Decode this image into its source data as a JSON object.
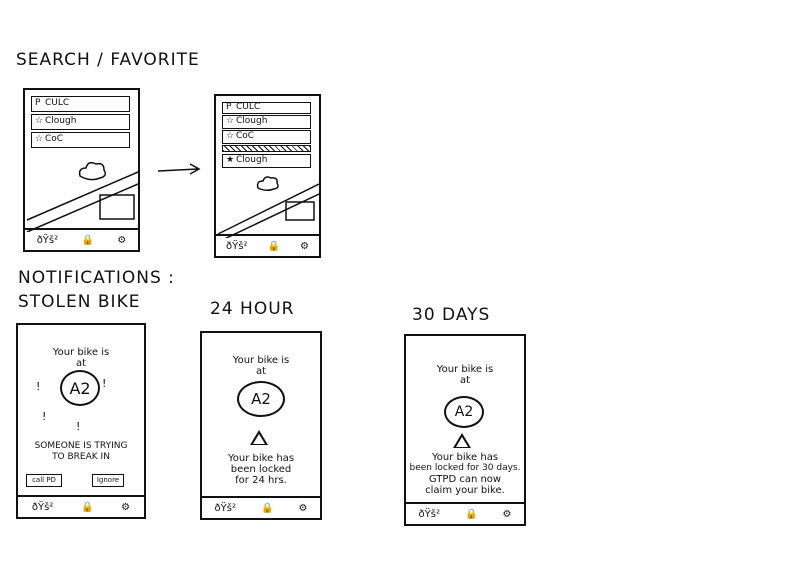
{
  "headings": {
    "search": "SEARCH / FAVORITE",
    "notifications": "NOTIFICATIONS :",
    "stolen": "STOLEN BIKE",
    "h24": "24 HOUR",
    "d30": "30 DAYS"
  },
  "search_before": {
    "rows": [
      {
        "icon": "P",
        "label": "CULC"
      },
      {
        "icon": "☆",
        "label": "Clough"
      },
      {
        "icon": "☆",
        "label": "CoC"
      }
    ]
  },
  "search_after": {
    "rows": [
      {
        "icon": "P",
        "label": "CULC"
      },
      {
        "icon": "☆",
        "label": "Clough"
      },
      {
        "icon": "☆",
        "label": "CoC"
      },
      {
        "icon": "★",
        "label": "Clough"
      }
    ]
  },
  "nav": {
    "bike": "ðŸš²",
    "lock": "🔒",
    "settings": "⚙"
  },
  "stolen": {
    "line1": "Your bike is",
    "line2": "at",
    "rack": "A2",
    "marks": "!",
    "alert1": "SOMEONE IS TRYING",
    "alert2": "TO BREAK IN",
    "call_btn": "call PD",
    "ignore_btn": "Ignore"
  },
  "h24": {
    "line1": "Your bike is",
    "line2": "at",
    "rack": "A2",
    "warn": "!",
    "msg1": "Your bike has",
    "msg2": "been locked",
    "msg3": "for 24 hrs."
  },
  "d30": {
    "line1": "Your bike is",
    "line2": "at",
    "rack": "A2",
    "warn": "!",
    "msg1": "Your bike has",
    "msg2": "been locked for 30 days.",
    "msg3": "GTPD can now",
    "msg4": "claim your bike."
  }
}
